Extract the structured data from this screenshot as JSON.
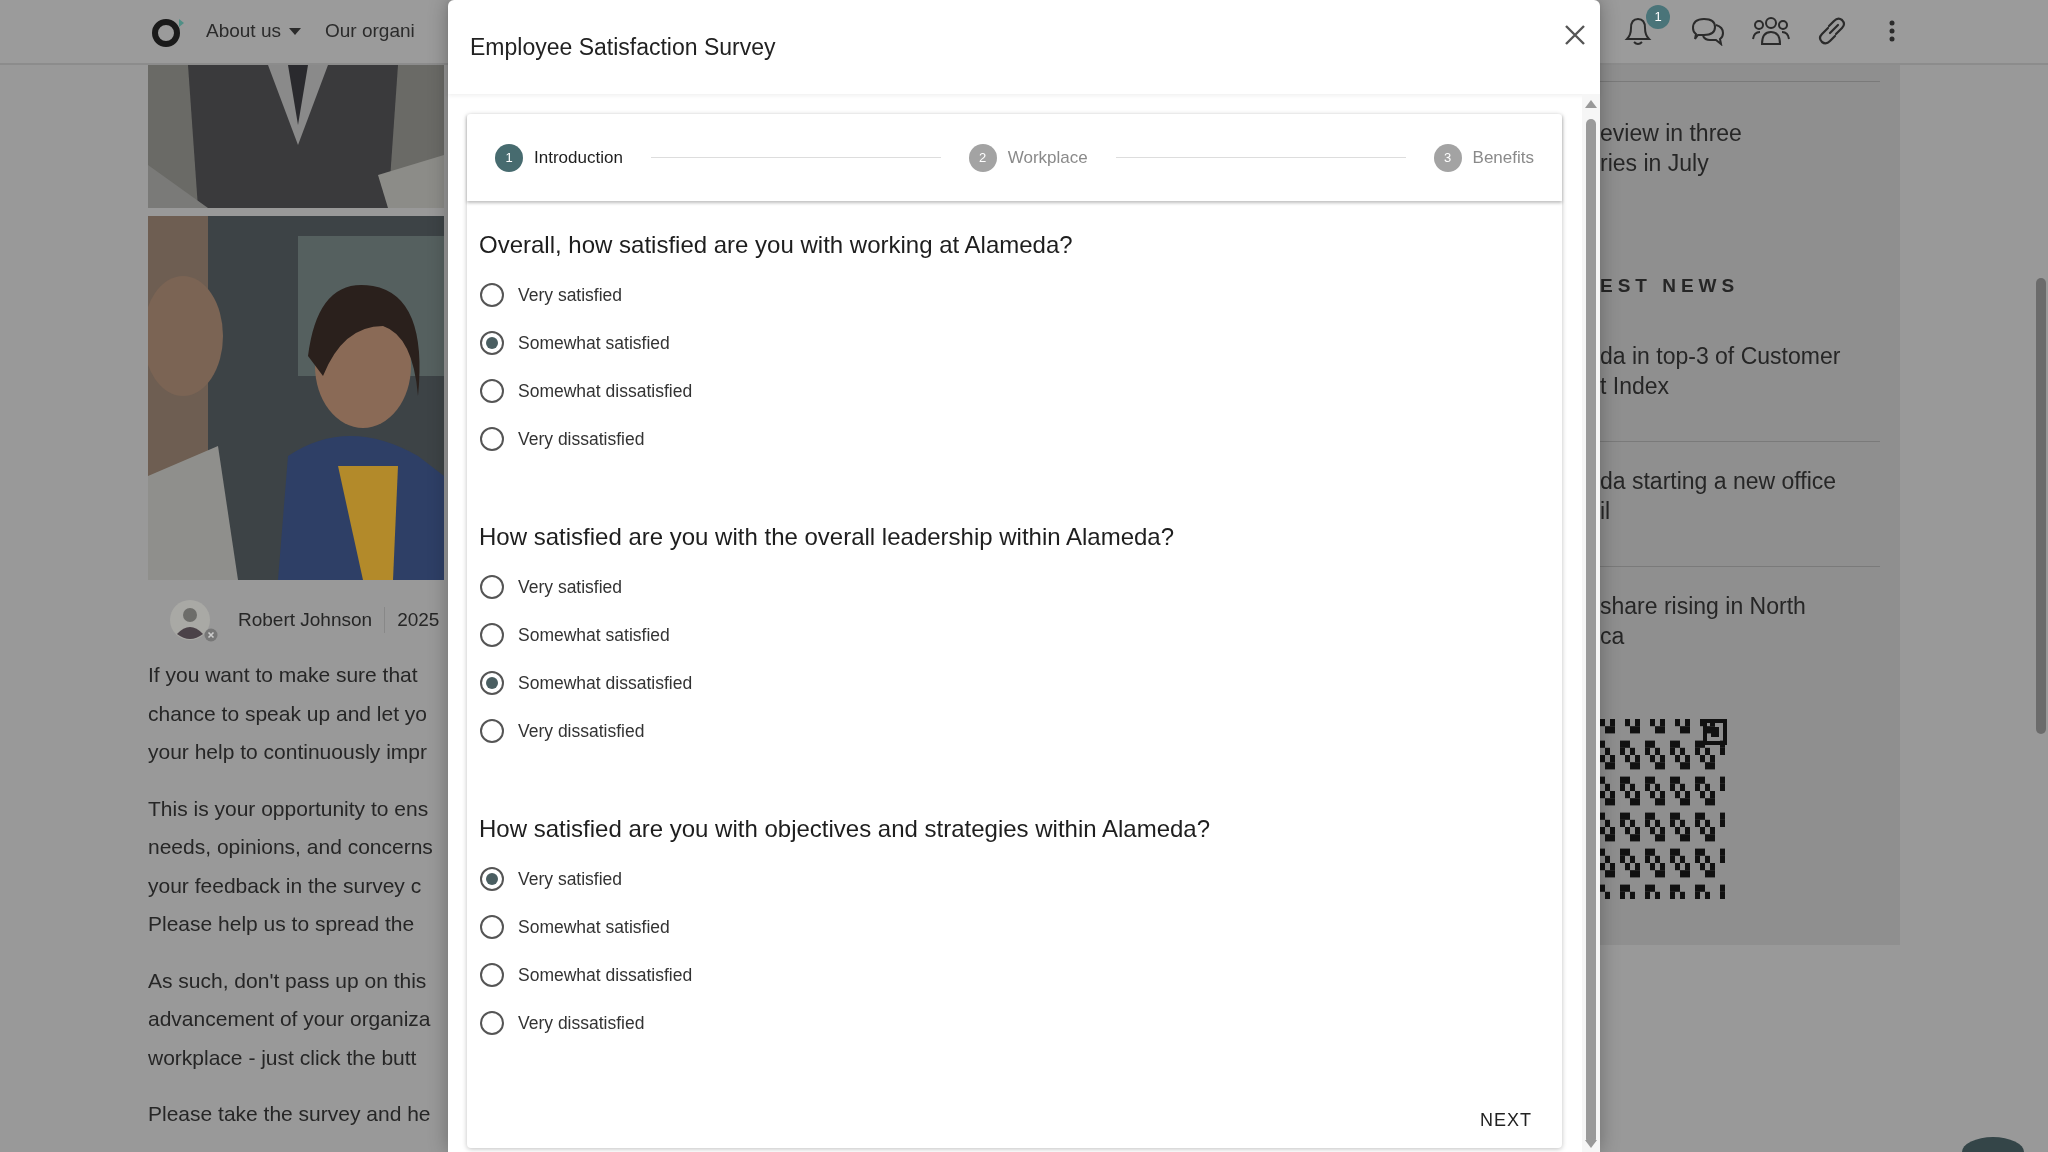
{
  "navbar": {
    "items": [
      {
        "label": "About us",
        "dropdown": true
      },
      {
        "label": "Our organi",
        "dropdown": false
      }
    ],
    "notification_count": "1"
  },
  "article": {
    "author": "Robert Johnson",
    "date": "2025",
    "paragraphs": [
      [
        "If you want to make sure that",
        "chance to speak up and let yo",
        "your help to continuously impr"
      ],
      [
        "This is your opportunity to ens",
        "needs, opinions, and concerns",
        "your feedback in the survey c",
        "Please help us to spread the"
      ],
      [
        "As such, don't pass up on this",
        "advancement of your organiza",
        "workplace - just click the butt"
      ],
      [
        "Please take the survey and he"
      ]
    ]
  },
  "sidebar": {
    "top_item": [
      "eview in three",
      "ries in July"
    ],
    "section_title": "EST NEWS",
    "news": [
      [
        "da in top-3 of Customer",
        "t Index"
      ],
      [
        "da starting a new office",
        "il"
      ],
      [
        "share rising in North",
        "ca"
      ]
    ]
  },
  "modal": {
    "title": "Employee Satisfaction Survey",
    "steps": [
      {
        "number": "1",
        "label": "Introduction",
        "selected": true
      },
      {
        "number": "2",
        "label": "Workplace",
        "selected": false
      },
      {
        "number": "3",
        "label": "Benefits",
        "selected": false
      }
    ],
    "questions": [
      {
        "text": "Overall, how satisfied are you with working at Alameda?",
        "options": [
          {
            "label": "Very satisfied",
            "selected": false
          },
          {
            "label": "Somewhat satisfied",
            "selected": true
          },
          {
            "label": "Somewhat dissatisfied",
            "selected": false
          },
          {
            "label": "Very dissatisfied",
            "selected": false
          }
        ]
      },
      {
        "text": "How satisfied are you with the overall leadership within Alameda?",
        "options": [
          {
            "label": "Very satisfied",
            "selected": false
          },
          {
            "label": "Somewhat satisfied",
            "selected": false
          },
          {
            "label": "Somewhat dissatisfied",
            "selected": true
          },
          {
            "label": "Very dissatisfied",
            "selected": false
          }
        ]
      },
      {
        "text": "How satisfied are you with objectives and strategies within Alameda?",
        "options": [
          {
            "label": "Very satisfied",
            "selected": true
          },
          {
            "label": "Somewhat satisfied",
            "selected": false
          },
          {
            "label": "Somewhat dissatisfied",
            "selected": false
          },
          {
            "label": "Very dissatisfied",
            "selected": false
          }
        ]
      }
    ],
    "next_button": "NEXT"
  }
}
